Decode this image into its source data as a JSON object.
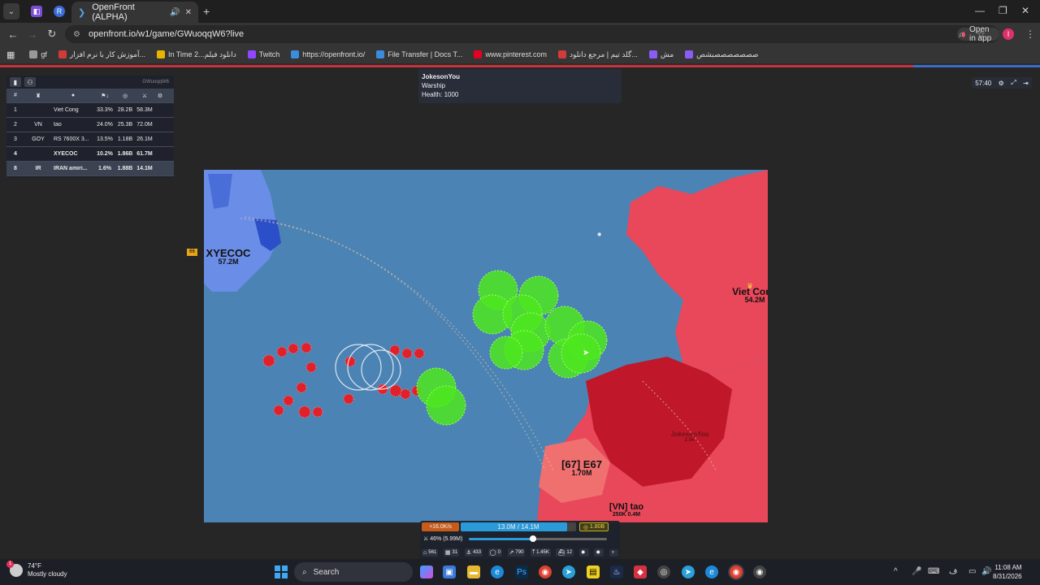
{
  "browser": {
    "tab_title": "OpenFront (ALPHA)",
    "url": "openfront.io/w1/game/GWuoqqW6?live",
    "open_in_app": "Open in app",
    "profile_initial": "I",
    "new_tab": "+",
    "bookmarks": [
      {
        "label": "gf",
        "color": "#999999"
      },
      {
        "label": "آموزش کار با نرم افزار...",
        "color": "#d23b3b"
      },
      {
        "label": "In Time 2...دانلود فیلم",
        "color": "#e8b400"
      },
      {
        "label": "Twitch",
        "color": "#9146ff"
      },
      {
        "label": "https://openfront.io/",
        "color": "#3a8ddd"
      },
      {
        "label": "File Transfer | Docs T...",
        "color": "#3a8ddd"
      },
      {
        "label": "www.pinterest.com",
        "color": "#e60023"
      },
      {
        "label": "گلد تیم | مرجع دانلود...",
        "color": "#d23b3b"
      },
      {
        "label": "مش",
        "color": "#8a5cf5"
      },
      {
        "label": "صصصصصصصبشص",
        "color": "#8a5cf5"
      }
    ]
  },
  "leaderboard": {
    "game_id": "GWuoqqW6",
    "headers": [
      "#",
      "♜",
      "●",
      "⚑↓",
      "◎",
      "⚔",
      "⚙"
    ],
    "rows": [
      {
        "rank": "1",
        "tag": "",
        "name": "Viet Cong",
        "land": "33.3%",
        "gold": "28.2B",
        "troops": "58.3M",
        "bold": false,
        "hl": false
      },
      {
        "rank": "2",
        "tag": "VN",
        "name": "tao",
        "land": "24.0%",
        "gold": "25.3B",
        "troops": "72.0M",
        "bold": false,
        "hl": false
      },
      {
        "rank": "3",
        "tag": "GOY",
        "name": "RS 7600X 3...",
        "land": "13.5%",
        "gold": "1.18B",
        "troops": "26.1M",
        "bold": false,
        "hl": false
      },
      {
        "rank": "4",
        "tag": "",
        "name": "XYECOC",
        "land": "10.2%",
        "gold": "1.86B",
        "troops": "61.7M",
        "bold": true,
        "hl": false
      },
      {
        "rank": "8",
        "tag": "IR",
        "name": "IRAN amiri...",
        "land": "1.6%",
        "gold": "1.88B",
        "troops": "14.1M",
        "bold": true,
        "hl": true
      }
    ]
  },
  "tooltip": {
    "name": "JokesonYou",
    "type": "Warship",
    "health": "Health: 1000"
  },
  "timer": {
    "time": "57:40"
  },
  "map": {
    "players": [
      {
        "name": "XYECOC",
        "troops": "57.2M"
      },
      {
        "name": "Viet Cong",
        "troops": "54.2M"
      },
      {
        "name": "[67] E67",
        "troops": "1.70M"
      },
      {
        "name": "[VN] tao",
        "troops": "250K 0.4M"
      },
      {
        "name": "JokesonYou",
        "troops": "2.5K"
      }
    ],
    "marker_tag": "66"
  },
  "hud": {
    "rate": "+16.0K/s",
    "troops": "13.0M / 14.1M",
    "troops_fill": 0.92,
    "gold": "1.80B",
    "attack_ratio": "46% (5.99M)",
    "attack_ratio_value": 0.46,
    "units": [
      {
        "icon": "city-icon",
        "glyph": "⌂",
        "value": "561"
      },
      {
        "icon": "factory-icon",
        "glyph": "▦",
        "value": "31"
      },
      {
        "icon": "port-icon",
        "glyph": "⚓",
        "value": "433"
      },
      {
        "icon": "defense-icon",
        "glyph": "◯",
        "value": "0"
      },
      {
        "icon": "missile-silo-icon",
        "glyph": "↗",
        "value": "790"
      },
      {
        "icon": "sam-icon",
        "glyph": "⤒",
        "value": "1.45K"
      },
      {
        "icon": "warship-icon",
        "glyph": "⛴",
        "value": "12"
      },
      {
        "icon": "atom-bomb-icon",
        "glyph": "✸",
        "value": ""
      },
      {
        "icon": "hydrogen-bomb-icon",
        "glyph": "✹",
        "value": ""
      },
      {
        "icon": "mirv-icon",
        "glyph": "♆",
        "value": ""
      }
    ]
  },
  "taskbar": {
    "temp": "74°F",
    "weather": "Mostly cloudy",
    "weather_badge": "1",
    "search": "Search",
    "time": "11:08 AM",
    "date": "8/31/2026"
  },
  "colors": {
    "ocean": "#4b83b4",
    "red_territory": "#e8485a",
    "dark_red_territory": "#c0182a",
    "blue_territory": "#6a8ee8",
    "green_circle": "#4ee81e"
  }
}
